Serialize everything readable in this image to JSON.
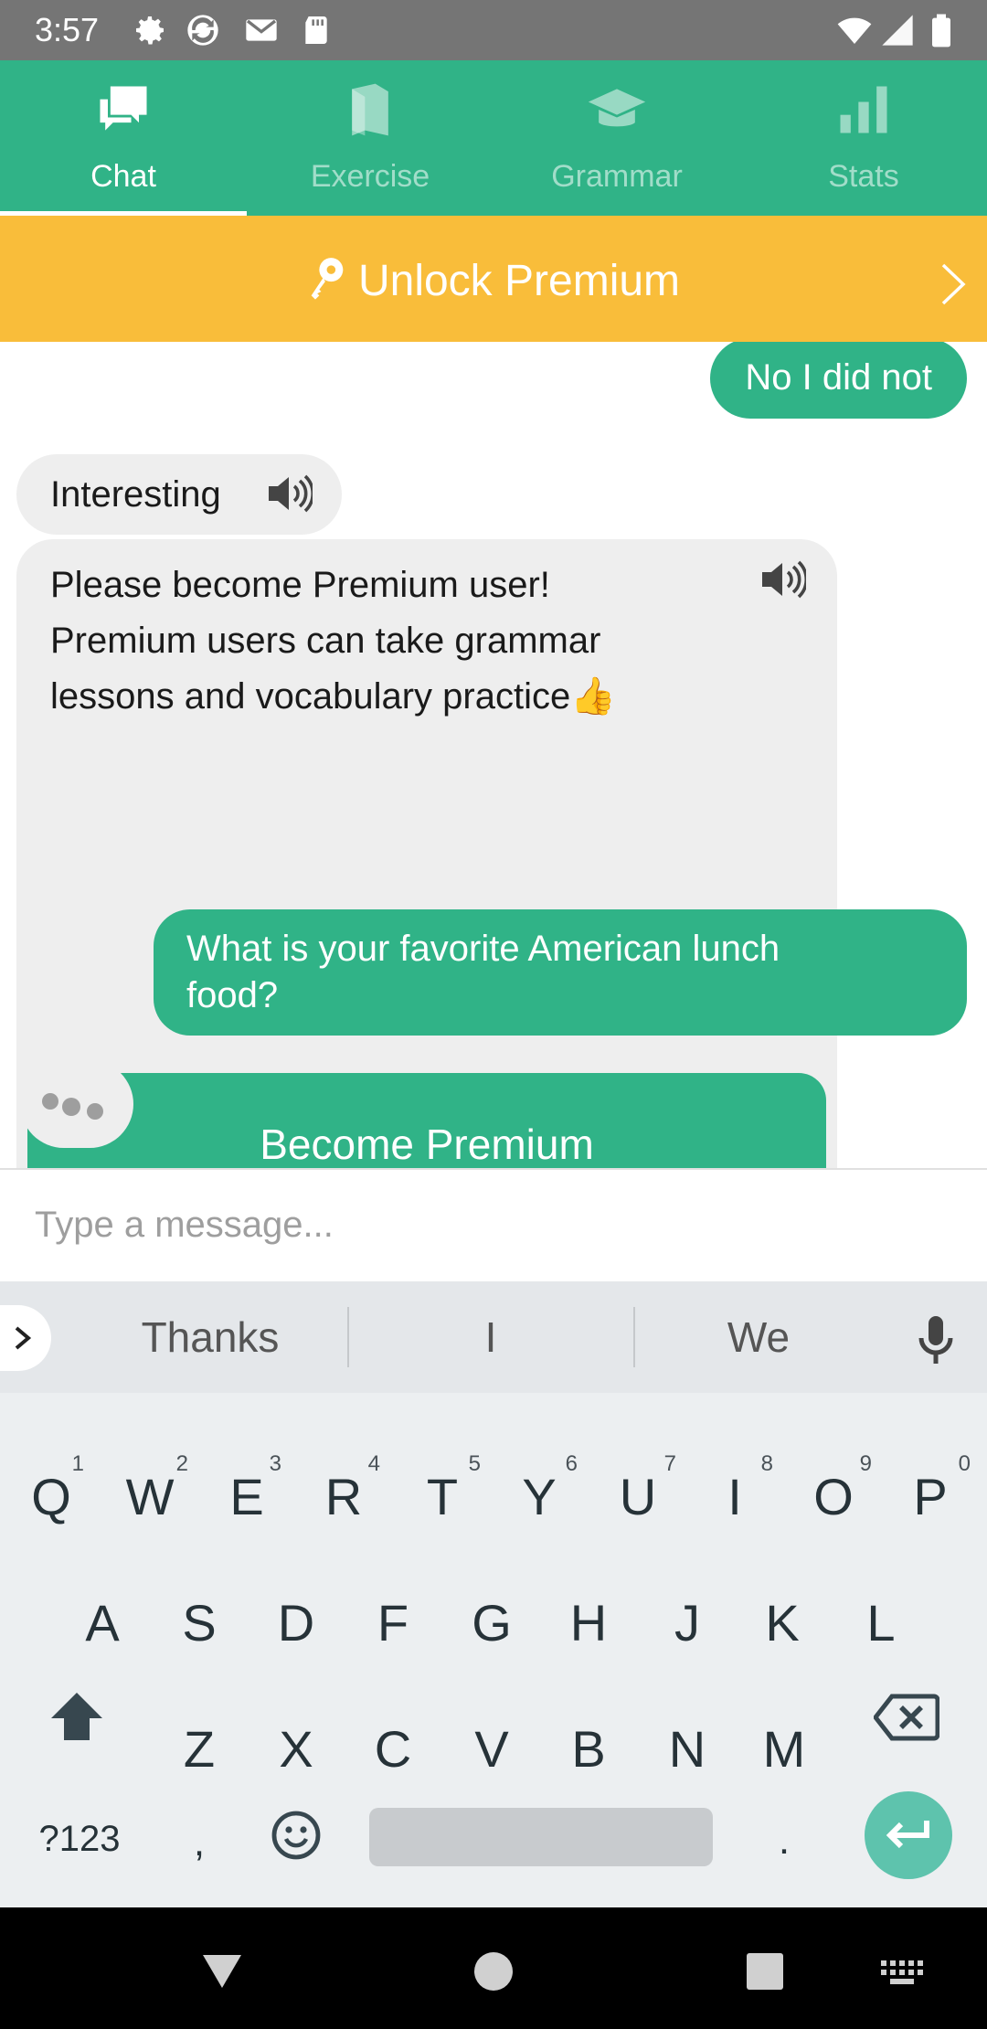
{
  "status_bar": {
    "time": "3:57"
  },
  "tabs": [
    {
      "label": "Chat",
      "active": true,
      "icon": "chat-bubbles-icon"
    },
    {
      "label": "Exercise",
      "active": false,
      "icon": "book-icon"
    },
    {
      "label": "Grammar",
      "active": false,
      "icon": "graduation-cap-icon"
    },
    {
      "label": "Stats",
      "active": false,
      "icon": "bar-chart-icon"
    }
  ],
  "banner": {
    "label": "Unlock Premium",
    "icon": "key-icon"
  },
  "messages": [
    {
      "from": "user",
      "text": "No I did not"
    },
    {
      "from": "bot",
      "text": "Interesting"
    },
    {
      "from": "bot",
      "lines": [
        "Please become Premium user!",
        "Premium users can take grammar",
        "lessons and vocabulary practice👍"
      ],
      "button": "Become Premium"
    },
    {
      "from": "user",
      "lines": [
        "What is your favorite American lunch",
        "food?"
      ]
    }
  ],
  "composer": {
    "placeholder": "Type a message..."
  },
  "keyboard": {
    "suggestions": [
      "Thanks",
      "I",
      "We"
    ],
    "row1": [
      "Q",
      "W",
      "E",
      "R",
      "T",
      "Y",
      "U",
      "I",
      "O",
      "P"
    ],
    "row1_hints": [
      "1",
      "2",
      "3",
      "4",
      "5",
      "6",
      "7",
      "8",
      "9",
      "0"
    ],
    "row2": [
      "A",
      "S",
      "D",
      "F",
      "G",
      "H",
      "J",
      "K",
      "L"
    ],
    "row3": [
      "Z",
      "X",
      "C",
      "V",
      "B",
      "N",
      "M"
    ],
    "symbols_key": "?123",
    "comma": ",",
    "period": "."
  },
  "colors": {
    "primary": "#30b387",
    "banner": "#f9bd3a",
    "bubble_in": "#eeeeee"
  }
}
